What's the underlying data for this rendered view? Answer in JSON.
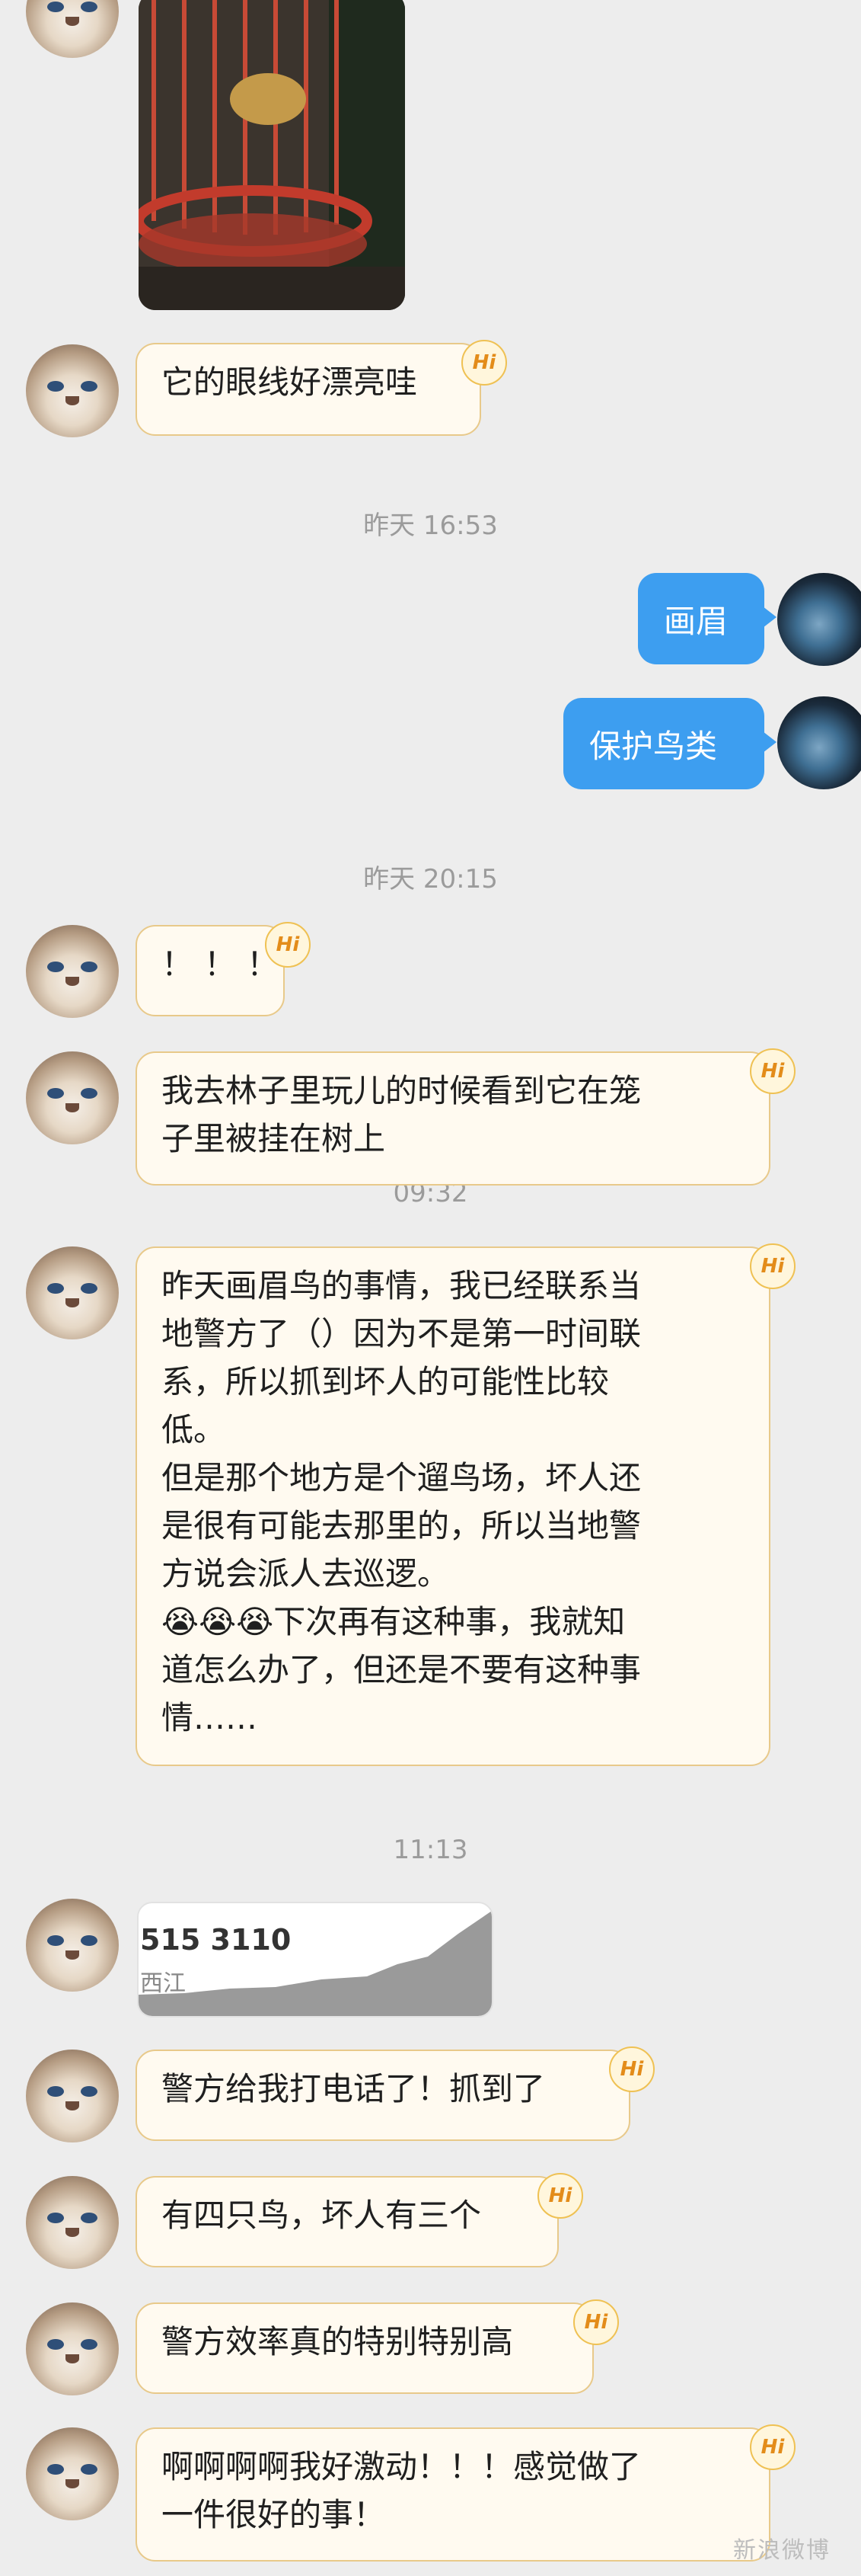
{
  "messages": {
    "m1": "它的眼线好漂亮哇",
    "m2": "画眉",
    "m3": "保护鸟类",
    "m4": "！！！",
    "m5": "我去林子里玩儿的时候看到它在笼\n子里被挂在树上",
    "m6": "昨天画眉鸟的事情，我已经联系当\n地警方了（）因为不是第一时间联\n系，所以抓到坏人的可能性比较\n低。\n但是那个地方是个遛鸟场，坏人还\n是很有可能去那里的，所以当地警\n方说会派人去巡逻。\n😭😭😭下次再有这种事，我就知\n道怎么办了，但还是不要有这种事\n情……",
    "m7": "警方给我打电话了！抓到了",
    "m8": "有四只鸟，坏人有三个",
    "m9": "警方效率真的特别特别高",
    "m10": "啊啊啊啊我好激动！！！感觉做了\n一件很好的事！"
  },
  "timestamps": {
    "t1": "昨天 16:53",
    "t2": "昨天 20:15",
    "t3": "09:32",
    "t4": "11:13"
  },
  "voice_card": {
    "number": "515 3110",
    "region": "西江"
  },
  "badge": "Hi",
  "watermark": "新浪微博",
  "colors": {
    "background": "#ededed",
    "left_bubble": "#fffaf0",
    "left_bubble_border": "#e8c98a",
    "right_bubble": "#3d9ef0",
    "badge_text": "#e38c1a"
  }
}
